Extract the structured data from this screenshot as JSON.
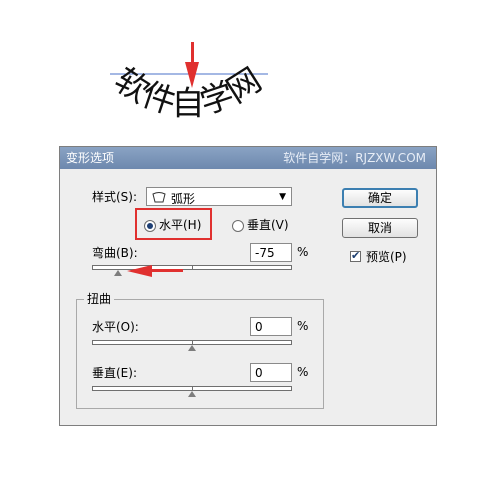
{
  "preview": {
    "text": "软件自学网"
  },
  "dialog": {
    "title": "变形选项",
    "watermark": "软件自学网：RJZXW.COM",
    "style": {
      "label": "样式(S):",
      "value": "弧形",
      "icon": "arc-shape-icon"
    },
    "orientation": {
      "horizontal_label": "水平(H)",
      "vertical_label": "垂直(V)",
      "selected": "horizontal"
    },
    "bend": {
      "label": "弯曲(B):",
      "value": "-75",
      "unit": "%"
    },
    "distortion": {
      "group_label": "扭曲",
      "horizontal": {
        "label": "水平(O):",
        "value": "0",
        "unit": "%"
      },
      "vertical": {
        "label": "垂直(E):",
        "value": "0",
        "unit": "%"
      }
    },
    "buttons": {
      "ok": "确定",
      "cancel": "取消"
    },
    "preview_checkbox": {
      "label": "预览(P)",
      "checked": true
    }
  },
  "colors": {
    "annotation_red": "#e0302f",
    "accent_blue": "#3c7fb1"
  }
}
